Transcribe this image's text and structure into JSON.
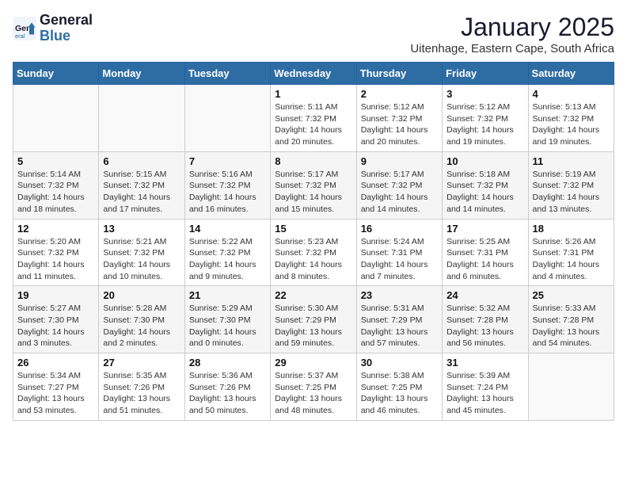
{
  "logo": {
    "line1": "General",
    "line2": "Blue"
  },
  "header": {
    "month": "January 2025",
    "location": "Uitenhage, Eastern Cape, South Africa"
  },
  "weekdays": [
    "Sunday",
    "Monday",
    "Tuesday",
    "Wednesday",
    "Thursday",
    "Friday",
    "Saturday"
  ],
  "weeks": [
    [
      {
        "day": "",
        "sunrise": "",
        "sunset": "",
        "daylight": ""
      },
      {
        "day": "",
        "sunrise": "",
        "sunset": "",
        "daylight": ""
      },
      {
        "day": "",
        "sunrise": "",
        "sunset": "",
        "daylight": ""
      },
      {
        "day": "1",
        "sunrise": "Sunrise: 5:11 AM",
        "sunset": "Sunset: 7:32 PM",
        "daylight": "Daylight: 14 hours and 20 minutes."
      },
      {
        "day": "2",
        "sunrise": "Sunrise: 5:12 AM",
        "sunset": "Sunset: 7:32 PM",
        "daylight": "Daylight: 14 hours and 20 minutes."
      },
      {
        "day": "3",
        "sunrise": "Sunrise: 5:12 AM",
        "sunset": "Sunset: 7:32 PM",
        "daylight": "Daylight: 14 hours and 19 minutes."
      },
      {
        "day": "4",
        "sunrise": "Sunrise: 5:13 AM",
        "sunset": "Sunset: 7:32 PM",
        "daylight": "Daylight: 14 hours and 19 minutes."
      }
    ],
    [
      {
        "day": "5",
        "sunrise": "Sunrise: 5:14 AM",
        "sunset": "Sunset: 7:32 PM",
        "daylight": "Daylight: 14 hours and 18 minutes."
      },
      {
        "day": "6",
        "sunrise": "Sunrise: 5:15 AM",
        "sunset": "Sunset: 7:32 PM",
        "daylight": "Daylight: 14 hours and 17 minutes."
      },
      {
        "day": "7",
        "sunrise": "Sunrise: 5:16 AM",
        "sunset": "Sunset: 7:32 PM",
        "daylight": "Daylight: 14 hours and 16 minutes."
      },
      {
        "day": "8",
        "sunrise": "Sunrise: 5:17 AM",
        "sunset": "Sunset: 7:32 PM",
        "daylight": "Daylight: 14 hours and 15 minutes."
      },
      {
        "day": "9",
        "sunrise": "Sunrise: 5:17 AM",
        "sunset": "Sunset: 7:32 PM",
        "daylight": "Daylight: 14 hours and 14 minutes."
      },
      {
        "day": "10",
        "sunrise": "Sunrise: 5:18 AM",
        "sunset": "Sunset: 7:32 PM",
        "daylight": "Daylight: 14 hours and 14 minutes."
      },
      {
        "day": "11",
        "sunrise": "Sunrise: 5:19 AM",
        "sunset": "Sunset: 7:32 PM",
        "daylight": "Daylight: 14 hours and 13 minutes."
      }
    ],
    [
      {
        "day": "12",
        "sunrise": "Sunrise: 5:20 AM",
        "sunset": "Sunset: 7:32 PM",
        "daylight": "Daylight: 14 hours and 11 minutes."
      },
      {
        "day": "13",
        "sunrise": "Sunrise: 5:21 AM",
        "sunset": "Sunset: 7:32 PM",
        "daylight": "Daylight: 14 hours and 10 minutes."
      },
      {
        "day": "14",
        "sunrise": "Sunrise: 5:22 AM",
        "sunset": "Sunset: 7:32 PM",
        "daylight": "Daylight: 14 hours and 9 minutes."
      },
      {
        "day": "15",
        "sunrise": "Sunrise: 5:23 AM",
        "sunset": "Sunset: 7:32 PM",
        "daylight": "Daylight: 14 hours and 8 minutes."
      },
      {
        "day": "16",
        "sunrise": "Sunrise: 5:24 AM",
        "sunset": "Sunset: 7:31 PM",
        "daylight": "Daylight: 14 hours and 7 minutes."
      },
      {
        "day": "17",
        "sunrise": "Sunrise: 5:25 AM",
        "sunset": "Sunset: 7:31 PM",
        "daylight": "Daylight: 14 hours and 6 minutes."
      },
      {
        "day": "18",
        "sunrise": "Sunrise: 5:26 AM",
        "sunset": "Sunset: 7:31 PM",
        "daylight": "Daylight: 14 hours and 4 minutes."
      }
    ],
    [
      {
        "day": "19",
        "sunrise": "Sunrise: 5:27 AM",
        "sunset": "Sunset: 7:30 PM",
        "daylight": "Daylight: 14 hours and 3 minutes."
      },
      {
        "day": "20",
        "sunrise": "Sunrise: 5:28 AM",
        "sunset": "Sunset: 7:30 PM",
        "daylight": "Daylight: 14 hours and 2 minutes."
      },
      {
        "day": "21",
        "sunrise": "Sunrise: 5:29 AM",
        "sunset": "Sunset: 7:30 PM",
        "daylight": "Daylight: 14 hours and 0 minutes."
      },
      {
        "day": "22",
        "sunrise": "Sunrise: 5:30 AM",
        "sunset": "Sunset: 7:29 PM",
        "daylight": "Daylight: 13 hours and 59 minutes."
      },
      {
        "day": "23",
        "sunrise": "Sunrise: 5:31 AM",
        "sunset": "Sunset: 7:29 PM",
        "daylight": "Daylight: 13 hours and 57 minutes."
      },
      {
        "day": "24",
        "sunrise": "Sunrise: 5:32 AM",
        "sunset": "Sunset: 7:28 PM",
        "daylight": "Daylight: 13 hours and 56 minutes."
      },
      {
        "day": "25",
        "sunrise": "Sunrise: 5:33 AM",
        "sunset": "Sunset: 7:28 PM",
        "daylight": "Daylight: 13 hours and 54 minutes."
      }
    ],
    [
      {
        "day": "26",
        "sunrise": "Sunrise: 5:34 AM",
        "sunset": "Sunset: 7:27 PM",
        "daylight": "Daylight: 13 hours and 53 minutes."
      },
      {
        "day": "27",
        "sunrise": "Sunrise: 5:35 AM",
        "sunset": "Sunset: 7:26 PM",
        "daylight": "Daylight: 13 hours and 51 minutes."
      },
      {
        "day": "28",
        "sunrise": "Sunrise: 5:36 AM",
        "sunset": "Sunset: 7:26 PM",
        "daylight": "Daylight: 13 hours and 50 minutes."
      },
      {
        "day": "29",
        "sunrise": "Sunrise: 5:37 AM",
        "sunset": "Sunset: 7:25 PM",
        "daylight": "Daylight: 13 hours and 48 minutes."
      },
      {
        "day": "30",
        "sunrise": "Sunrise: 5:38 AM",
        "sunset": "Sunset: 7:25 PM",
        "daylight": "Daylight: 13 hours and 46 minutes."
      },
      {
        "day": "31",
        "sunrise": "Sunrise: 5:39 AM",
        "sunset": "Sunset: 7:24 PM",
        "daylight": "Daylight: 13 hours and 45 minutes."
      },
      {
        "day": "",
        "sunrise": "",
        "sunset": "",
        "daylight": ""
      }
    ]
  ]
}
